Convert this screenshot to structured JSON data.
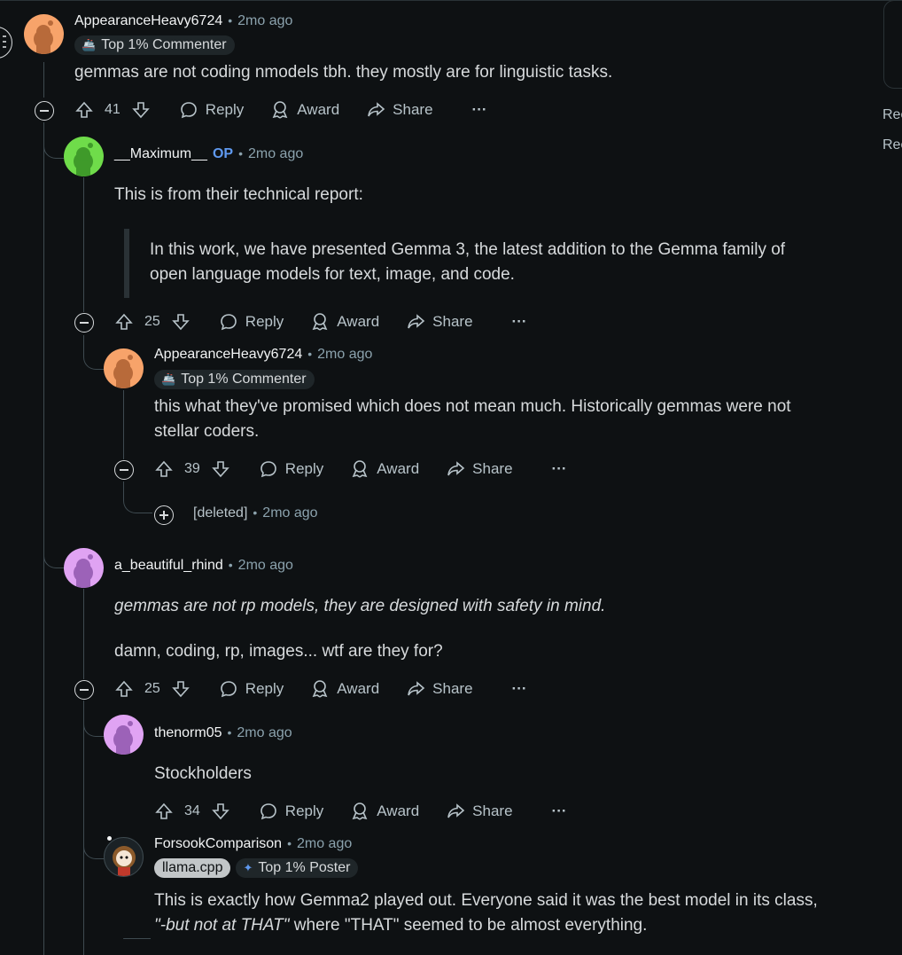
{
  "comments": [
    {
      "username": "AppearanceHeavy6724",
      "time": "2mo ago",
      "flair": "Top 1% Commenter",
      "body": "gemmas are not coding nmodels tbh. they mostly are for linguistic tasks.",
      "votes": "41",
      "avatar_color": "#f7a36a"
    },
    {
      "username": "__Maximum__",
      "op": "OP",
      "time": "2mo ago",
      "body": "This is from their technical report:",
      "quote": "In this work, we have presented Gemma 3, the latest addition to the Gemma family of open language models for text, image, and code.",
      "votes": "25",
      "avatar_color": "#6fdc4a"
    },
    {
      "username": "AppearanceHeavy6724",
      "time": "2mo ago",
      "flair": "Top 1% Commenter",
      "body": "this what they've promised which does not mean much. Historically gemmas were not stellar coders.",
      "votes": "39",
      "avatar_color": "#f7a36a"
    },
    {
      "username": "[deleted]",
      "time": "2mo ago"
    },
    {
      "username": "a_beautiful_rhind",
      "time": "2mo ago",
      "quote_italic": "gemmas are not rp models, they are designed with safety in mind.",
      "body": "damn, coding, rp, images... wtf are they for?",
      "votes": "25",
      "avatar_color": "#e0a3f3"
    },
    {
      "username": "thenorm05",
      "time": "2mo ago",
      "body": "Stockholders",
      "votes": "34",
      "avatar_color": "#e0a3f3"
    },
    {
      "username": "ForsookComparison",
      "time": "2mo ago",
      "flair_grey": "llama.cpp",
      "flair": "Top 1% Poster",
      "body_line1": "This is exactly how Gemma2 played out. Everyone said it was the best model in its class,",
      "body_italic": "\"-but not at THAT\"",
      "body_line2_rest": " where \"THAT\" seemed to be almost everything."
    }
  ],
  "labels": {
    "reply": "Reply",
    "award": "Award",
    "share": "Share",
    "more": "···"
  },
  "right_rail": [
    "Rec",
    "Rec"
  ],
  "colors": {
    "background": "#0e1113",
    "op_blue": "#5f99ef",
    "meta_grey": "#8ba2ad"
  }
}
